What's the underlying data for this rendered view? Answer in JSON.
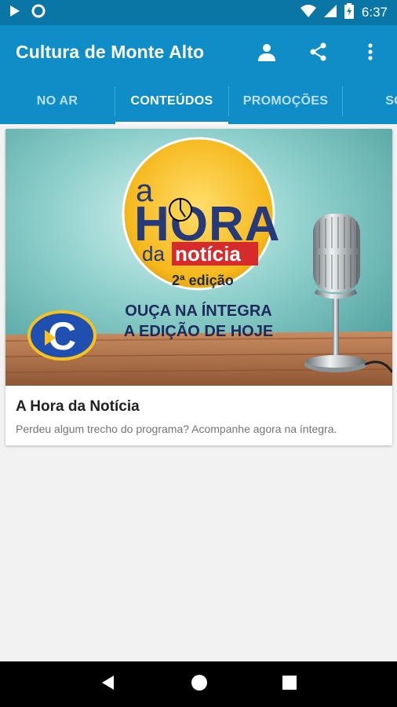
{
  "status_bar": {
    "time": "6:37",
    "icons": [
      "play-icon",
      "circle-icon",
      "wifi-icon",
      "signal-icon",
      "battery-icon"
    ]
  },
  "app_bar": {
    "title": "Cultura de Monte Alto",
    "actions": [
      "account-icon",
      "share-icon",
      "more-vert-icon"
    ]
  },
  "tabs": [
    {
      "label": "NO AR",
      "active": false
    },
    {
      "label": "CONTEÚDOS",
      "active": true
    },
    {
      "label": "PROMOÇÕES",
      "active": false
    },
    {
      "label": "SOC",
      "active": false
    }
  ],
  "card": {
    "title": "A Hora da Notícia",
    "description": "Perdeu algum trecho do programa? Acompanhe agora na íntegra.",
    "image": {
      "logo_line1": "a",
      "logo_line2": "HORA",
      "logo_line3": "da",
      "logo_line4": "notícia",
      "logo_edition": "2ª edição",
      "caption_line1": "OUÇA NA ÍNTEGRA",
      "caption_line2": "A EDIÇÃO DE HOJE",
      "brand_letter": "C"
    }
  },
  "nav_bar": {
    "buttons": [
      "back-icon",
      "home-icon",
      "recents-icon"
    ]
  },
  "colors": {
    "status_bar": "#0a76a6",
    "app_bar": "#0e8dc7",
    "background": "#f2f2f2"
  }
}
